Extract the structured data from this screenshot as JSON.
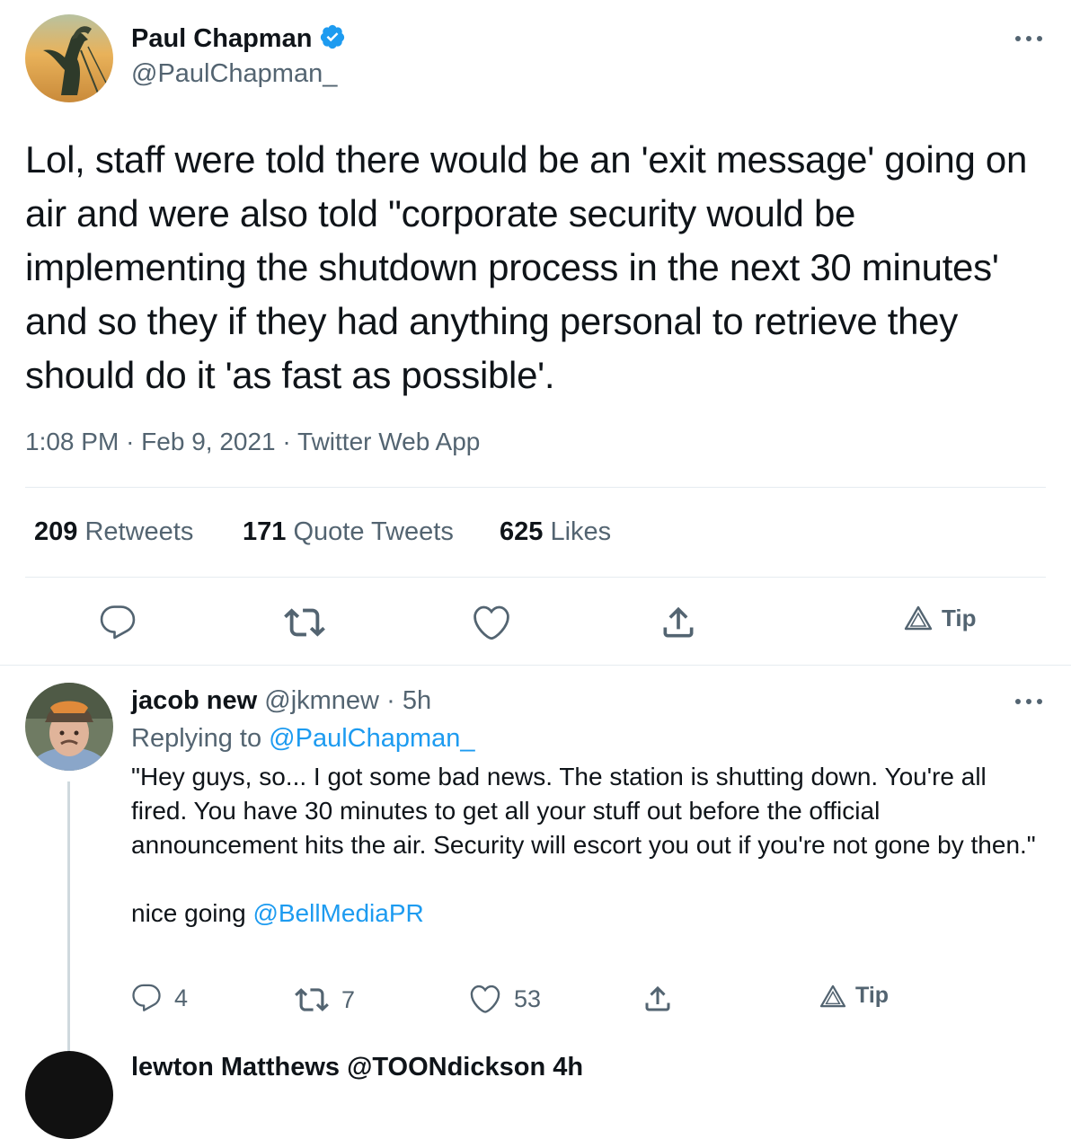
{
  "main_tweet": {
    "author": {
      "name": "Paul Chapman",
      "handle": "@PaulChapman_",
      "verified": true,
      "avatar_icon": "liver-bird-statue-avatar"
    },
    "more_icon": "more-horizontal-icon",
    "text": "Lol, staff were told there would be an 'exit message' going on air and were also told \"corporate security would be implementing the shutdown process in the next 30 minutes' and so they if they had anything personal to retrieve they should do it 'as fast as possible'.",
    "meta": {
      "time": "1:08 PM",
      "sep1": "·",
      "date": "Feb 9, 2021",
      "sep2": "·",
      "source": "Twitter Web App"
    },
    "stats": {
      "retweets_count": "209",
      "retweets_label": "Retweets",
      "quotes_count": "171",
      "quotes_label": "Quote Tweets",
      "likes_count": "625",
      "likes_label": "Likes"
    },
    "actions": {
      "reply_icon": "comment-icon",
      "retweet_icon": "retweet-icon",
      "like_icon": "heart-icon",
      "share_icon": "share-icon",
      "tip_label": "Tip"
    }
  },
  "reply": {
    "author": {
      "name": "jacob new",
      "handle": "@jkmnew",
      "sep": "·",
      "time": "5h",
      "avatar_icon": "man-with-cap-avatar"
    },
    "replying_to_label": "Replying to",
    "replying_to_handle": "@PaulChapman_",
    "text_quote": "\"Hey guys, so... I got some bad news. The station is shutting down. You're all fired. You have 30 minutes to get all your stuff out before the official announcement hits the air. Security will escort you out if you're not gone by then.\"",
    "text_suffix": "nice going",
    "mention": "@BellMediaPR",
    "actions": {
      "reply_count": "4",
      "retweet_count": "7",
      "like_count": "53",
      "tip_label": "Tip"
    }
  },
  "next_reply": {
    "partial_text": "lewton Matthews @TOONdickson 4h"
  },
  "colors": {
    "link": "#1d9bf0",
    "muted": "#536471",
    "text": "#0f1419",
    "divider": "#e6ecf0",
    "verified": "#1d9bf0"
  }
}
